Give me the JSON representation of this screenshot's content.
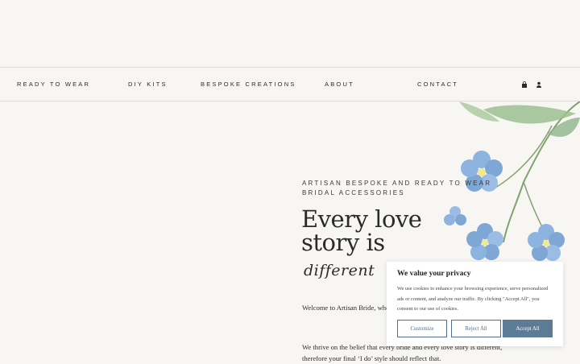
{
  "nav": {
    "items": [
      "READY TO WEAR",
      "DIY KITS",
      "BESPOKE CREATIONS",
      "ABOUT",
      "CONTACT"
    ],
    "icons": [
      "bag-icon",
      "user-icon"
    ]
  },
  "hero": {
    "eyebrow_line1": "ARTISAN BESPOKE AND READY TO WEAR",
    "eyebrow_line2": "BRIDAL ACCESSORIES",
    "headline_line1": "Every love",
    "headline_line2": "story is",
    "script": "different",
    "paragraph1": "Welcome to Artisan Bride, where ... bridal trends to offer a world of w... budget.",
    "paragraph2": "We thrive on the belief that every bride and every love story is different, therefore your final ‘I do’ style should reflect that."
  },
  "cookie": {
    "title": "We value your privacy",
    "text": "We use cookies to enhance your browsing experience, serve personalized ads or content, and analyze our traffic. By clicking \"Accept All\", you consent to our use of cookies.",
    "customize_label": "Customize",
    "reject_label": "Reject All",
    "accept_label": "Accept All",
    "accent_color": "#5c7c96"
  },
  "colors": {
    "background": "#f7f6f3",
    "flower_blue": "#7fa7d6",
    "leaf_green": "#8fb58a"
  }
}
